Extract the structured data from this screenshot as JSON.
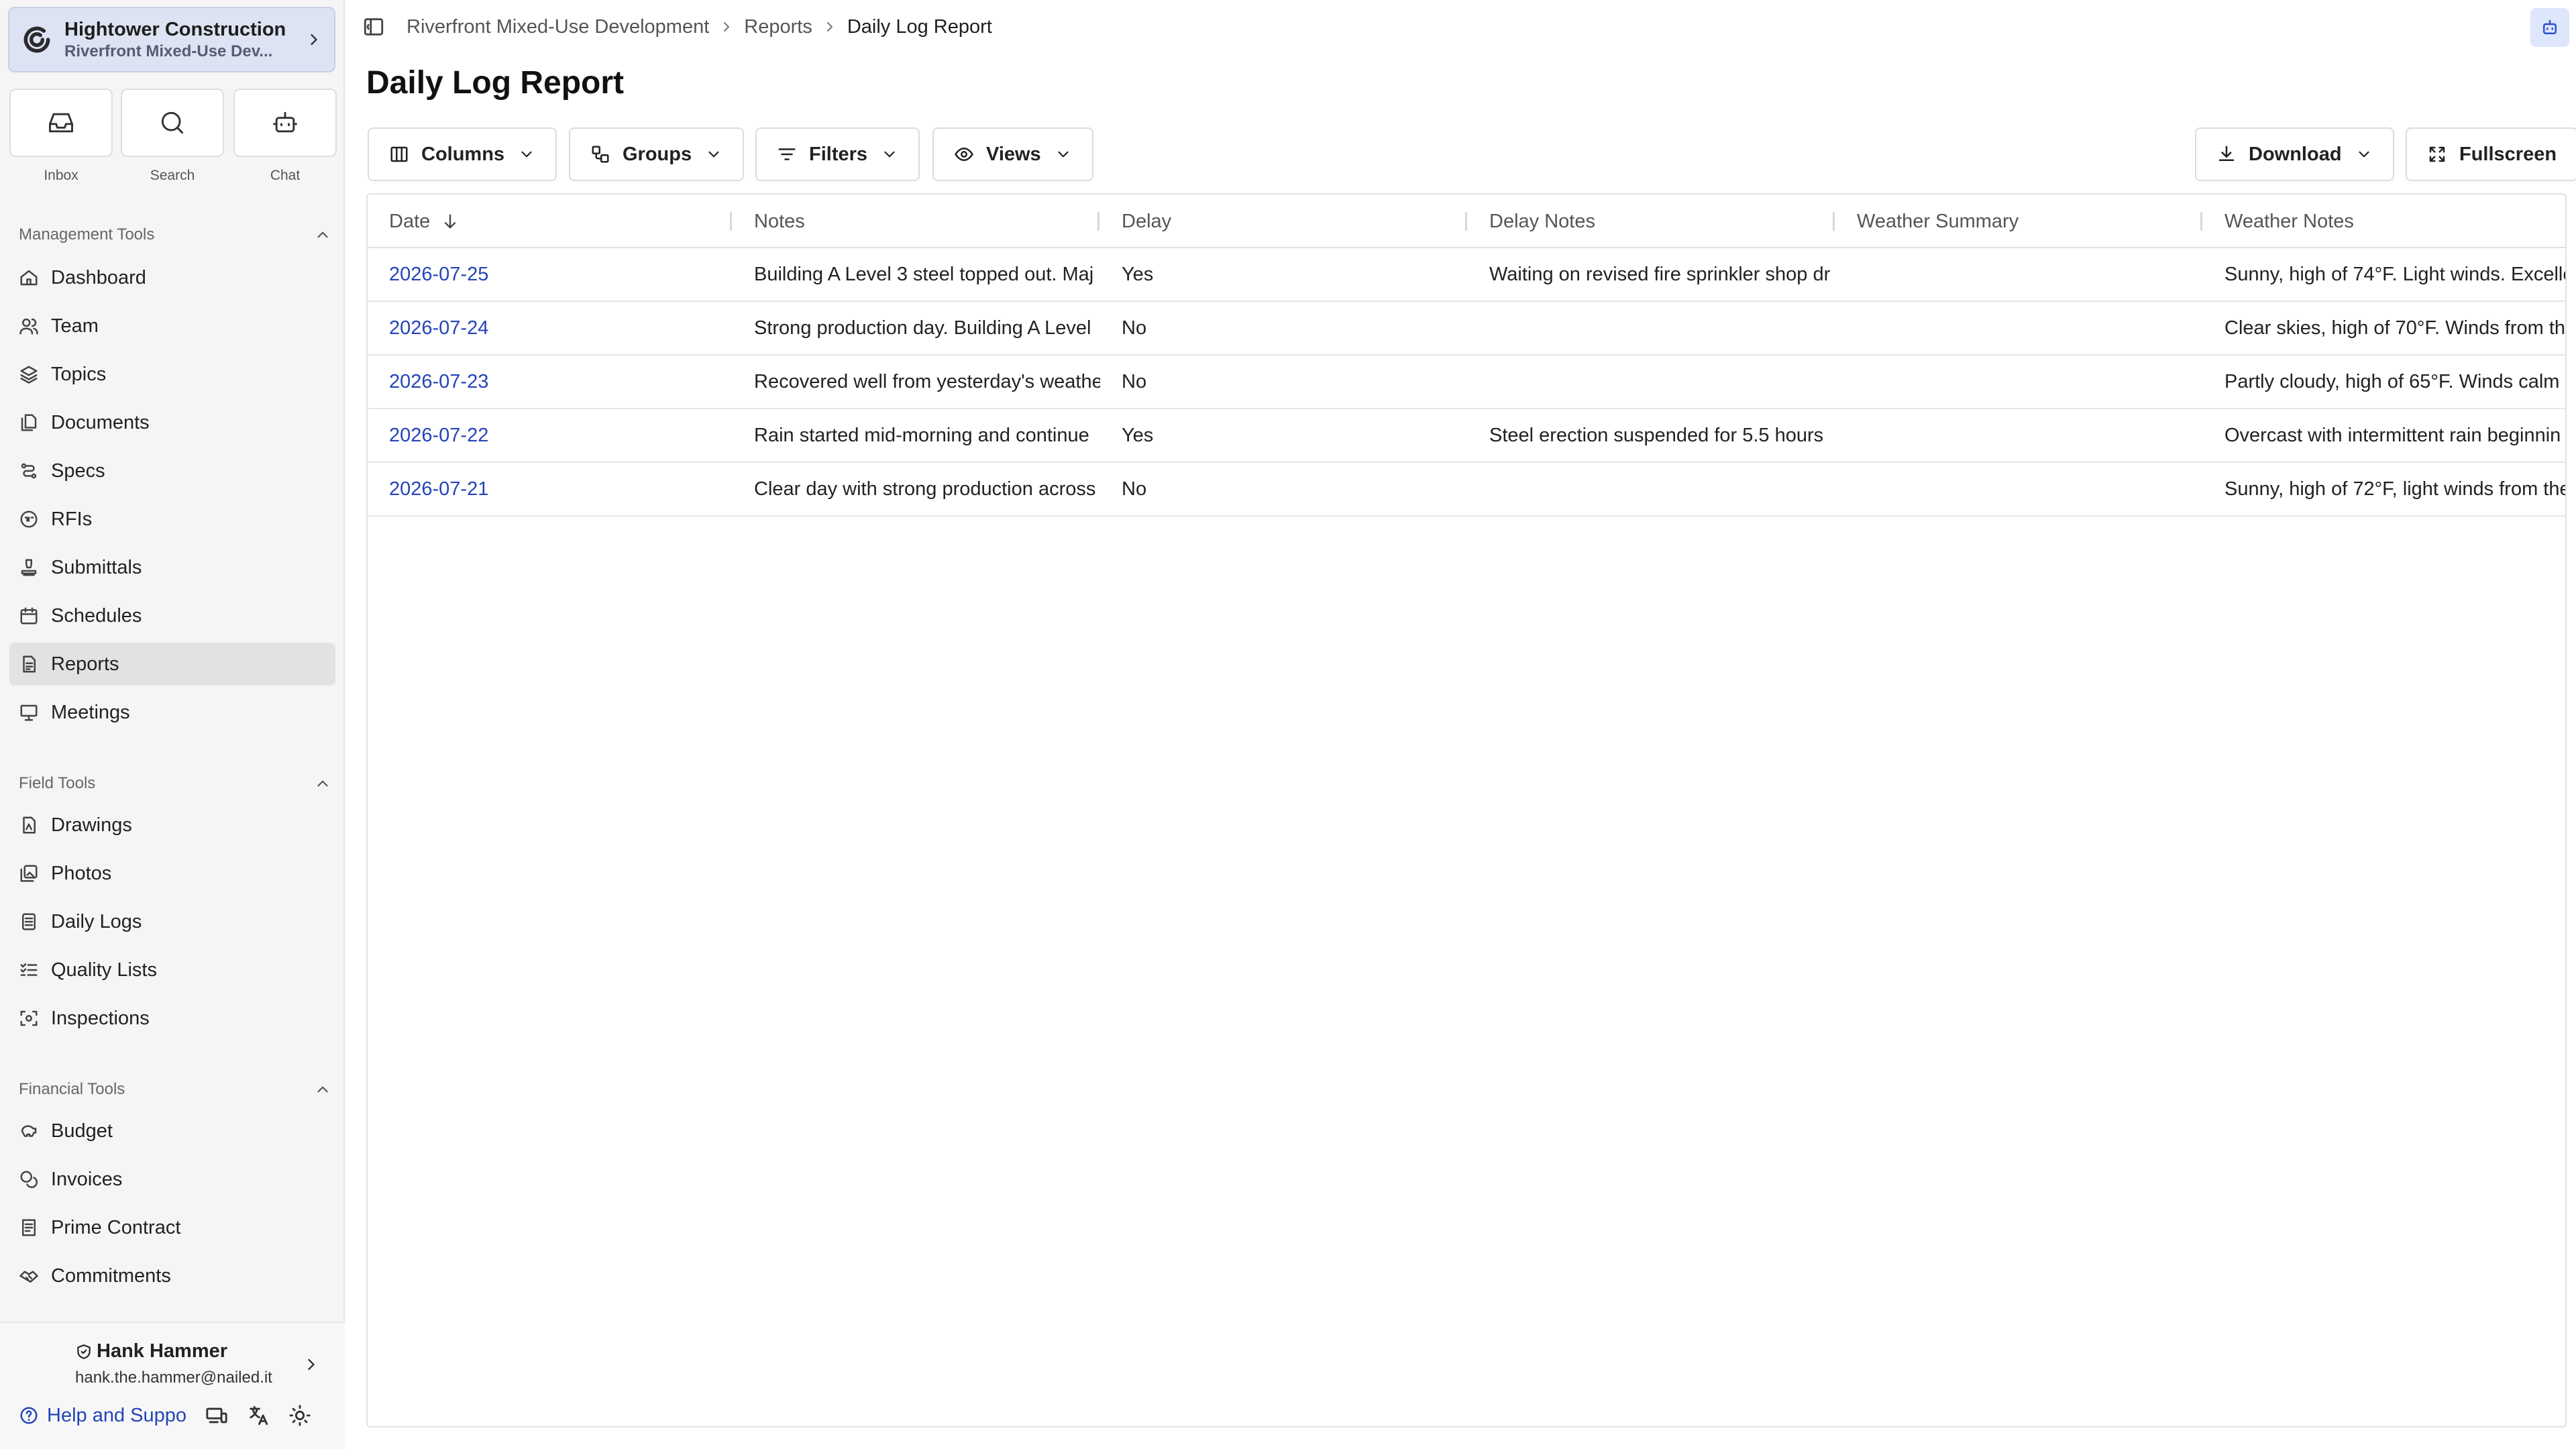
{
  "org": {
    "name": "Hightower Construction",
    "project": "Riverfront Mixed-Use Dev..."
  },
  "quick_actions": [
    {
      "label": "Inbox",
      "icon": "inbox-icon"
    },
    {
      "label": "Search",
      "icon": "search-icon"
    },
    {
      "label": "Chat",
      "icon": "bot-icon"
    }
  ],
  "sections": {
    "management": {
      "title": "Management Tools",
      "items": [
        {
          "label": "Dashboard",
          "icon": "home-icon"
        },
        {
          "label": "Team",
          "icon": "users-icon"
        },
        {
          "label": "Topics",
          "icon": "layers-icon"
        },
        {
          "label": "Documents",
          "icon": "files-icon"
        },
        {
          "label": "Specs",
          "icon": "specs-icon"
        },
        {
          "label": "RFIs",
          "icon": "rfi-icon"
        },
        {
          "label": "Submittals",
          "icon": "stamp-icon"
        },
        {
          "label": "Schedules",
          "icon": "calendar-icon"
        },
        {
          "label": "Reports",
          "icon": "report-icon"
        },
        {
          "label": "Meetings",
          "icon": "presentation-icon"
        }
      ]
    },
    "field": {
      "title": "Field Tools",
      "items": [
        {
          "label": "Drawings",
          "icon": "drawing-icon"
        },
        {
          "label": "Photos",
          "icon": "photos-icon"
        },
        {
          "label": "Daily Logs",
          "icon": "log-icon"
        },
        {
          "label": "Quality Lists",
          "icon": "checklist-icon"
        },
        {
          "label": "Inspections",
          "icon": "scan-icon"
        }
      ]
    },
    "financial": {
      "title": "Financial Tools",
      "items": [
        {
          "label": "Budget",
          "icon": "piggy-bank-icon"
        },
        {
          "label": "Invoices",
          "icon": "coins-icon"
        },
        {
          "label": "Prime Contract",
          "icon": "contract-icon"
        },
        {
          "label": "Commitments",
          "icon": "handshake-icon"
        }
      ]
    }
  },
  "active_nav": "Reports",
  "user": {
    "name": "Hank Hammer",
    "email": "hank.the.hammer@nailed.it"
  },
  "footer": {
    "help_label": "Help and Suppo"
  },
  "breadcrumb": [
    "Riverfront Mixed-Use Development",
    "Reports",
    "Daily Log Report"
  ],
  "page": {
    "title": "Daily Log Report"
  },
  "toolbar": {
    "columns": "Columns",
    "groups": "Groups",
    "filters": "Filters",
    "views": "Views",
    "download": "Download",
    "fullscreen": "Fullscreen"
  },
  "table": {
    "columns": [
      "Date",
      "Notes",
      "Delay",
      "Delay Notes",
      "Weather Summary",
      "Weather Notes"
    ],
    "sort": {
      "column": "Date",
      "direction": "descending"
    },
    "rows": [
      [
        "2026-07-25",
        "Building A Level 3 steel topped out. Maj",
        "Yes",
        "Waiting on revised fire sprinkler shop dr",
        "",
        "Sunny, high of 74°F. Light winds. Excelle"
      ],
      [
        "2026-07-24",
        "Strong production day. Building A Level",
        "No",
        "",
        "",
        "Clear skies, high of 70°F. Winds from th"
      ],
      [
        "2026-07-23",
        "Recovered well from yesterday's weathe",
        "No",
        "",
        "",
        "Partly cloudy, high of 65°F. Winds calm"
      ],
      [
        "2026-07-22",
        "Rain started mid-morning and continue",
        "Yes",
        "Steel erection suspended for 5.5 hours",
        "",
        "Overcast with intermittent rain beginnin"
      ],
      [
        "2026-07-21",
        "Clear day with strong production across",
        "No",
        "",
        "",
        "Sunny, high of 72°F, light winds from the"
      ]
    ]
  },
  "colors": {
    "accent": "#2444b8",
    "org_bg": "#dde3f3",
    "active_bg": "#e2e2e2",
    "ai_button_bg": "#dde6fb"
  }
}
